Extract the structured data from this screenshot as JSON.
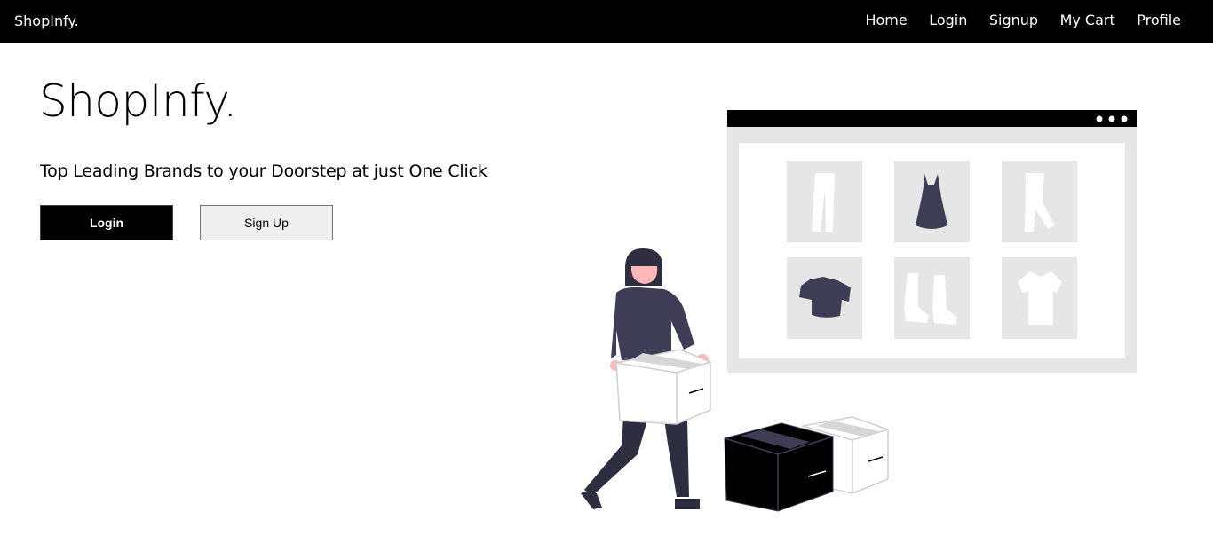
{
  "navbar": {
    "brand": "ShopInfy.",
    "links": [
      "Home",
      "Login",
      "Signup",
      "My Cart",
      "Profile"
    ]
  },
  "hero": {
    "title": "ShopInfy.",
    "subtitle": "Top Leading Brands to your Doorstep at just One Click",
    "login_label": "Login",
    "signup_label": "Sign Up"
  },
  "colors": {
    "navbar_bg": "#000000",
    "accent": "#3f3d56",
    "panel": "#e6e6e6"
  }
}
